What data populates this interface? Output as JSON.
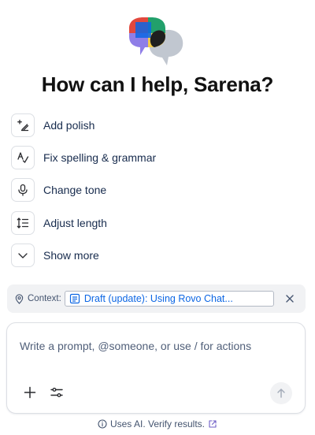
{
  "header": {
    "logo_icon": "rovo-chat-bubbles-icon",
    "title": "How can I help, Sarena?"
  },
  "actions": [
    {
      "icon": "sparkle-pen-icon",
      "label": "Add polish"
    },
    {
      "icon": "spellcheck-icon",
      "label": "Fix spelling & grammar"
    },
    {
      "icon": "microphone-icon",
      "label": "Change tone"
    },
    {
      "icon": "adjust-length-icon",
      "label": "Adjust length"
    },
    {
      "icon": "chevron-down-icon",
      "label": "Show more"
    }
  ],
  "context": {
    "label": "Context:",
    "chip_text": "Draft (update): Using Rovo Chat..."
  },
  "prompt": {
    "placeholder": "Write a prompt, @someone, or use / for actions"
  },
  "footer": {
    "text": "Uses AI. Verify results."
  },
  "colors": {
    "link": "#0c66e4",
    "text": "#172b4d",
    "subtle": "#44546f",
    "context_bg": "#f1f2f4"
  }
}
